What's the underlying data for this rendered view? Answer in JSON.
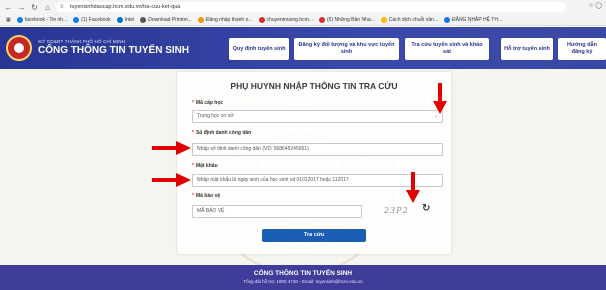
{
  "browser": {
    "url": "tuyensinhdaucap.hcm.edu.vn/tra-cuu-ket-qua",
    "bookmarks": [
      {
        "label": "facebook - Tin nh...",
        "color": "#1877f2"
      },
      {
        "label": "(1) Facebook",
        "color": "#1877f2"
      },
      {
        "label": "Intel",
        "color": "#0071c5"
      },
      {
        "label": "Download Printon...",
        "color": "#555555"
      },
      {
        "label": "Đăng nhập thanh o...",
        "color": "#f29900"
      },
      {
        "label": "chuyenmuong.hcm...",
        "color": "#d32f2f"
      },
      {
        "label": "(6) Những Bản Nha...",
        "color": "#d32f2f"
      },
      {
        "label": "Cách dịch chuỗi văn...",
        "color": "#fbbc04"
      },
      {
        "label": "ĐĂNG NHẬP HỆ TH...",
        "color": "#1a73e8"
      }
    ]
  },
  "header": {
    "org_small": "SỞ GD&ĐT THÀNH PHỐ HỒ CHÍ MINH",
    "org_title": "CỔNG THÔNG TIN TUYỂN SINH",
    "menu": [
      "Quy định tuyển sinh",
      "Đăng ký đối tượng và khu vực tuyển sinh",
      "Tra cứu tuyển sinh và khảo sát",
      "Hỗ trợ tuyển sinh",
      "Hướng dẫn đăng ký"
    ]
  },
  "form": {
    "title": "PHỤ HUYNH NHẬP THÔNG TIN TRA CỨU",
    "level_label": "Mã cấp học",
    "level_value": "Trung học cơ sở",
    "id_label": "Số định danh công dân",
    "id_placeholder": "Nhập số định danh công dân (VD: 568645245651)",
    "password_label": "Mật khẩu",
    "password_placeholder": "Nhập mật khẩu là ngày sinh của học sinh vd 01012017 hoặc 112017",
    "captcha_label": "Mã bảo vệ",
    "captcha_placeholder": "MÃ BẢO VỆ",
    "captcha_text": "23P2",
    "submit_label": "Tra cứu"
  },
  "footer": {
    "title": "CỔNG THÔNG TIN TUYỂN SINH",
    "contact": "Tổng đài hỗ trợ: 1900 4740 - Email: tuyensinh@hcm.edu.vn"
  },
  "colors": {
    "header_bg": "#2e3192",
    "arrow": "#e00000",
    "submit_bg": "#1a5fb4"
  }
}
